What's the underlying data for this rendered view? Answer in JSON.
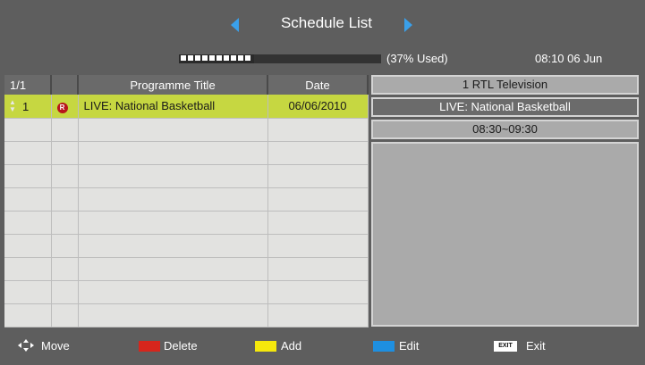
{
  "header": {
    "title": "Schedule List",
    "usage_text": "(37% Used)",
    "usage_fraction": 0.37,
    "clock": "08:10  06 Jun",
    "arrow_color": "#3aa0ea"
  },
  "table": {
    "columns": [
      "1/1",
      "",
      "Programme Title",
      "Date"
    ],
    "rows": [
      {
        "num": "1",
        "badge": "R",
        "title": "LIVE: National Basketball",
        "date": "06/06/2010"
      }
    ],
    "empty_rows": 9,
    "selected_color": "#c6d741"
  },
  "detail": {
    "channel": "1 RTL Television",
    "programme": "LIVE: National Basketball",
    "time": "08:30~09:30"
  },
  "footer": {
    "move": "Move",
    "delete": "Delete",
    "add": "Add",
    "edit": "Edit",
    "exit_key": "EXIT",
    "exit": "Exit",
    "colors": {
      "red": "#d6261c",
      "yellow": "#f5e80c",
      "blue": "#1e8fe0"
    }
  }
}
